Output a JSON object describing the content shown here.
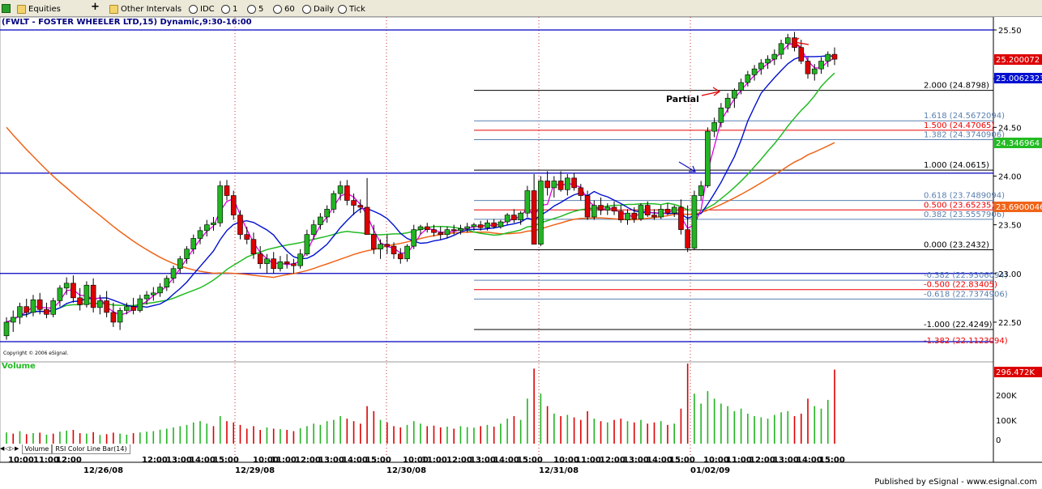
{
  "toolbar": {
    "symbol_icon": "chart-icon",
    "market_label": "Equities",
    "add_icon": "plus-icon",
    "other_intervals_label": "Other Intervals",
    "interval_prefix": "IDC",
    "interval_1": "1",
    "interval_5": "5",
    "interval_60": "60",
    "interval_daily": "Daily",
    "interval_tick": "Tick"
  },
  "chart_title": "(FWLT - FOSTER WHEELER LTD,15) Dynamic,9:30-16:00",
  "copyright": "Copyright © 2006 eSignal.",
  "volume_label": "Volume",
  "bottom_tabs": [
    "Volume",
    "RSI Color Line Bar(14)"
  ],
  "published": "Published by eSignal - www.esignal.com",
  "colors": {
    "up_candle": "#22b422",
    "down_candle": "#dd0000",
    "ma_fast": "#e000e0",
    "ma_mid": "#0010d0",
    "ma_slow": "#22bb22",
    "ma_long": "#f06418",
    "hline": "#0000c0",
    "fib_grey": "#5a80b0",
    "fib_red": "#ee0000",
    "fib_black": "#000000"
  },
  "chart_data": {
    "type": "candlestick",
    "title": "(FWLT - FOSTER WHEELER LTD,15) Dynamic,9:30-16:00",
    "y_axis": {
      "min": 22.3,
      "max": 25.5,
      "ticks": [
        "25.50",
        "25.00",
        "24.50",
        "24.00",
        "23.50",
        "23.00",
        "22.50"
      ]
    },
    "x_axis": {
      "time_labels": [
        "10:00",
        "11:00",
        "12:00",
        "10:00",
        "11:00",
        "12:00",
        "13:00",
        "14:00",
        "15:00",
        "10:00",
        "11:00",
        "12:00",
        "13:00",
        "14:00",
        "15:00",
        "10:00",
        "11:00",
        "12:00",
        "13:00",
        "14:00",
        "15:00",
        "10:00",
        "11:00",
        "12:00",
        "13:00",
        "14:00",
        "15:00"
      ],
      "date_labels": [
        "12/26/08",
        "12/29/08",
        "12/30/08",
        "12/31/08",
        "01/02/09"
      ]
    },
    "price_badges": [
      {
        "value": "25.200072",
        "color": "#dd0000"
      },
      {
        "value": "25.0062323",
        "color": "#0010d0"
      },
      {
        "value": "24.346964",
        "color": "#22bb22"
      },
      {
        "value": "23.6900046",
        "color": "#f06418"
      }
    ],
    "horizontal_lines": [
      25.5,
      24.03,
      23.0,
      22.3
    ],
    "fib_levels": [
      {
        "label": "2.000 (24.8798)",
        "value": 24.8798,
        "color": "black"
      },
      {
        "label": "1.618 (24.5672094)",
        "value": 24.5672,
        "color": "grey"
      },
      {
        "label": "1.500 (24.47065)",
        "value": 24.4707,
        "color": "red"
      },
      {
        "label": "1.382 (24.3740906)",
        "value": 24.3741,
        "color": "grey"
      },
      {
        "label": "1.000 (24.0615)",
        "value": 24.0615,
        "color": "black"
      },
      {
        "label": "0.618 (23.7489094)",
        "value": 23.7489,
        "color": "grey"
      },
      {
        "label": "0.500 (23.65235)",
        "value": 23.6524,
        "color": "red"
      },
      {
        "label": "0.382 (23.5557906)",
        "value": 23.5558,
        "color": "grey"
      },
      {
        "label": "0.000 (23.2432)",
        "value": 23.2432,
        "color": "black"
      },
      {
        "label": "-0.382 (22.9306094)",
        "value": 22.9306,
        "color": "grey"
      },
      {
        "label": "-0.500 (22.83405)",
        "value": 22.8341,
        "color": "red"
      },
      {
        "label": "-0.618 (22.7374906)",
        "value": 22.7375,
        "color": "grey"
      },
      {
        "label": "-1.000 (22.4249)",
        "value": 22.4249,
        "color": "black"
      },
      {
        "label": "-1.382 (22.1123094)",
        "value": 22.1123,
        "color": "red"
      }
    ],
    "annotations": [
      {
        "text": "Partial"
      }
    ],
    "candles": [
      [
        22.36,
        22.55,
        22.32,
        22.5
      ],
      [
        22.5,
        22.62,
        22.4,
        22.55
      ],
      [
        22.55,
        22.7,
        22.48,
        22.66
      ],
      [
        22.66,
        22.74,
        22.55,
        22.6
      ],
      [
        22.6,
        22.78,
        22.56,
        22.73
      ],
      [
        22.73,
        22.8,
        22.58,
        22.63
      ],
      [
        22.63,
        22.7,
        22.54,
        22.58
      ],
      [
        22.58,
        22.75,
        22.55,
        22.72
      ],
      [
        22.72,
        22.88,
        22.66,
        22.85
      ],
      [
        22.85,
        22.96,
        22.78,
        22.9
      ],
      [
        22.9,
        22.98,
        22.7,
        22.75
      ],
      [
        22.75,
        22.85,
        22.62,
        22.68
      ],
      [
        22.68,
        22.92,
        22.65,
        22.88
      ],
      [
        22.88,
        22.95,
        22.6,
        22.65
      ],
      [
        22.65,
        22.78,
        22.58,
        22.72
      ],
      [
        22.72,
        22.82,
        22.55,
        22.6
      ],
      [
        22.6,
        22.7,
        22.45,
        22.5
      ],
      [
        22.5,
        22.65,
        22.42,
        22.62
      ],
      [
        22.62,
        22.7,
        22.58,
        22.66
      ],
      [
        22.66,
        22.75,
        22.58,
        22.62
      ],
      [
        22.62,
        22.78,
        22.6,
        22.74
      ],
      [
        22.74,
        22.82,
        22.68,
        22.78
      ],
      [
        22.78,
        22.86,
        22.72,
        22.8
      ],
      [
        22.8,
        22.9,
        22.76,
        22.86
      ],
      [
        22.86,
        22.98,
        22.82,
        22.95
      ],
      [
        22.95,
        23.08,
        22.9,
        23.05
      ],
      [
        23.05,
        23.18,
        23.0,
        23.15
      ],
      [
        23.15,
        23.28,
        23.1,
        23.25
      ],
      [
        23.25,
        23.4,
        23.2,
        23.36
      ],
      [
        23.36,
        23.48,
        23.3,
        23.44
      ],
      [
        23.44,
        23.55,
        23.38,
        23.5
      ],
      [
        23.5,
        23.58,
        23.44,
        23.52
      ],
      [
        23.52,
        23.95,
        23.48,
        23.9
      ],
      [
        23.9,
        23.96,
        23.75,
        23.8
      ],
      [
        23.8,
        23.85,
        23.55,
        23.6
      ],
      [
        23.6,
        23.65,
        23.35,
        23.4
      ],
      [
        23.4,
        23.48,
        23.3,
        23.35
      ],
      [
        23.35,
        23.42,
        23.15,
        23.2
      ],
      [
        23.2,
        23.28,
        23.05,
        23.1
      ],
      [
        23.1,
        23.2,
        23.0,
        23.15
      ],
      [
        23.15,
        23.22,
        23.0,
        23.05
      ],
      [
        23.05,
        23.18,
        23.02,
        23.12
      ],
      [
        23.12,
        23.2,
        23.05,
        23.1
      ],
      [
        23.1,
        23.15,
        23.0,
        23.08
      ],
      [
        23.08,
        23.25,
        23.05,
        23.2
      ],
      [
        23.2,
        23.45,
        23.18,
        23.4
      ],
      [
        23.4,
        23.55,
        23.35,
        23.5
      ],
      [
        23.5,
        23.62,
        23.45,
        23.58
      ],
      [
        23.58,
        23.7,
        23.52,
        23.66
      ],
      [
        23.66,
        23.85,
        23.62,
        23.82
      ],
      [
        23.82,
        23.95,
        23.75,
        23.9
      ],
      [
        23.9,
        23.96,
        23.7,
        23.75
      ],
      [
        23.75,
        23.82,
        23.6,
        23.7
      ],
      [
        23.7,
        23.76,
        23.62,
        23.68
      ],
      [
        23.68,
        23.98,
        23.5,
        23.4
      ],
      [
        23.4,
        23.5,
        23.2,
        23.25
      ],
      [
        23.25,
        23.35,
        23.15,
        23.3
      ],
      [
        23.3,
        23.4,
        23.2,
        23.28
      ],
      [
        23.28,
        23.32,
        23.15,
        23.2
      ],
      [
        23.2,
        23.26,
        23.1,
        23.15
      ],
      [
        23.15,
        23.3,
        23.12,
        23.28
      ],
      [
        23.28,
        23.5,
        23.25,
        23.45
      ],
      [
        23.45,
        23.5,
        23.4,
        23.48
      ],
      [
        23.48,
        23.52,
        23.42,
        23.45
      ],
      [
        23.45,
        23.5,
        23.38,
        23.42
      ],
      [
        23.42,
        23.48,
        23.35,
        23.4
      ],
      [
        23.4,
        23.48,
        23.36,
        23.45
      ],
      [
        23.45,
        23.5,
        23.4,
        23.44
      ],
      [
        23.44,
        23.5,
        23.4,
        23.46
      ],
      [
        23.46,
        23.52,
        23.42,
        23.48
      ],
      [
        23.48,
        23.52,
        23.44,
        23.5
      ],
      [
        23.5,
        23.54,
        23.44,
        23.47
      ],
      [
        23.47,
        23.55,
        23.44,
        23.52
      ],
      [
        23.52,
        23.56,
        23.46,
        23.48
      ],
      [
        23.48,
        23.55,
        23.46,
        23.53
      ],
      [
        23.53,
        23.62,
        23.5,
        23.6
      ],
      [
        23.6,
        23.66,
        23.52,
        23.55
      ],
      [
        23.55,
        23.64,
        23.5,
        23.62
      ],
      [
        23.62,
        23.9,
        23.58,
        23.85
      ],
      [
        23.85,
        24.02,
        23.3,
        23.3
      ],
      [
        23.3,
        24.0,
        23.28,
        23.95
      ],
      [
        23.95,
        24.05,
        23.8,
        23.88
      ],
      [
        23.88,
        24.0,
        23.78,
        23.95
      ],
      [
        23.95,
        24.05,
        23.84,
        23.86
      ],
      [
        23.86,
        24.02,
        23.8,
        23.98
      ],
      [
        23.98,
        24.03,
        23.85,
        23.88
      ],
      [
        23.88,
        23.92,
        23.75,
        23.8
      ],
      [
        23.8,
        23.85,
        23.55,
        23.58
      ],
      [
        23.58,
        23.75,
        23.55,
        23.7
      ],
      [
        23.7,
        23.78,
        23.6,
        23.65
      ],
      [
        23.65,
        23.72,
        23.6,
        23.68
      ],
      [
        23.68,
        23.74,
        23.6,
        23.64
      ],
      [
        23.64,
        23.7,
        23.52,
        23.55
      ],
      [
        23.55,
        23.66,
        23.5,
        23.62
      ],
      [
        23.62,
        23.68,
        23.52,
        23.56
      ],
      [
        23.56,
        23.72,
        23.54,
        23.7
      ],
      [
        23.7,
        23.74,
        23.58,
        23.6
      ],
      [
        23.6,
        23.66,
        23.55,
        23.58
      ],
      [
        23.58,
        23.7,
        23.56,
        23.66
      ],
      [
        23.66,
        23.72,
        23.6,
        23.62
      ],
      [
        23.62,
        23.7,
        23.58,
        23.68
      ],
      [
        23.68,
        23.76,
        23.4,
        23.45
      ],
      [
        23.45,
        23.7,
        23.22,
        23.26
      ],
      [
        23.26,
        23.85,
        23.24,
        23.8
      ],
      [
        23.8,
        23.95,
        23.75,
        23.9
      ],
      [
        23.9,
        24.5,
        23.88,
        24.46
      ],
      [
        24.46,
        24.6,
        24.4,
        24.55
      ],
      [
        24.55,
        24.75,
        24.5,
        24.7
      ],
      [
        24.7,
        24.85,
        24.65,
        24.8
      ],
      [
        24.8,
        24.9,
        24.7,
        24.88
      ],
      [
        24.88,
        25.0,
        24.84,
        24.96
      ],
      [
        24.96,
        25.08,
        24.92,
        25.04
      ],
      [
        25.04,
        25.14,
        24.98,
        25.1
      ],
      [
        25.1,
        25.2,
        25.04,
        25.16
      ],
      [
        25.16,
        25.24,
        25.1,
        25.2
      ],
      [
        25.2,
        25.3,
        25.14,
        25.25
      ],
      [
        25.25,
        25.4,
        25.2,
        25.36
      ],
      [
        25.36,
        25.46,
        25.3,
        25.42
      ],
      [
        25.42,
        25.48,
        25.28,
        25.32
      ],
      [
        25.32,
        25.4,
        25.15,
        25.18
      ],
      [
        25.18,
        25.22,
        25.0,
        25.05
      ],
      [
        25.05,
        25.15,
        24.98,
        25.1
      ],
      [
        25.1,
        25.22,
        25.05,
        25.18
      ],
      [
        25.18,
        25.28,
        25.12,
        25.25
      ],
      [
        25.25,
        25.32,
        25.14,
        25.2
      ]
    ],
    "volume": {
      "ticks": [
        "200K",
        "100K",
        "0"
      ],
      "last_value": "296.472K",
      "bars": [
        [
          45,
          1
        ],
        [
          40,
          0
        ],
        [
          50,
          1
        ],
        [
          38,
          0
        ],
        [
          42,
          1
        ],
        [
          44,
          0
        ],
        [
          36,
          1
        ],
        [
          40,
          0
        ],
        [
          48,
          1
        ],
        [
          52,
          1
        ],
        [
          55,
          0
        ],
        [
          42,
          0
        ],
        [
          40,
          1
        ],
        [
          46,
          0
        ],
        [
          35,
          1
        ],
        [
          38,
          0
        ],
        [
          44,
          0
        ],
        [
          40,
          1
        ],
        [
          36,
          1
        ],
        [
          42,
          0
        ],
        [
          45,
          1
        ],
        [
          48,
          1
        ],
        [
          50,
          1
        ],
        [
          56,
          1
        ],
        [
          60,
          1
        ],
        [
          65,
          1
        ],
        [
          70,
          1
        ],
        [
          75,
          1
        ],
        [
          85,
          1
        ],
        [
          90,
          1
        ],
        [
          80,
          1
        ],
        [
          70,
          0
        ],
        [
          110,
          1
        ],
        [
          90,
          0
        ],
        [
          85,
          0
        ],
        [
          75,
          0
        ],
        [
          60,
          0
        ],
        [
          70,
          0
        ],
        [
          55,
          0
        ],
        [
          65,
          1
        ],
        [
          60,
          0
        ],
        [
          58,
          1
        ],
        [
          55,
          0
        ],
        [
          50,
          0
        ],
        [
          62,
          1
        ],
        [
          70,
          1
        ],
        [
          80,
          1
        ],
        [
          75,
          1
        ],
        [
          90,
          1
        ],
        [
          95,
          1
        ],
        [
          110,
          1
        ],
        [
          100,
          0
        ],
        [
          90,
          0
        ],
        [
          80,
          0
        ],
        [
          150,
          0
        ],
        [
          130,
          0
        ],
        [
          95,
          1
        ],
        [
          85,
          0
        ],
        [
          70,
          0
        ],
        [
          65,
          0
        ],
        [
          75,
          1
        ],
        [
          90,
          1
        ],
        [
          80,
          1
        ],
        [
          70,
          0
        ],
        [
          72,
          0
        ],
        [
          65,
          0
        ],
        [
          68,
          1
        ],
        [
          60,
          0
        ],
        [
          70,
          1
        ],
        [
          66,
          1
        ],
        [
          64,
          1
        ],
        [
          70,
          0
        ],
        [
          75,
          1
        ],
        [
          68,
          0
        ],
        [
          80,
          1
        ],
        [
          100,
          1
        ],
        [
          110,
          0
        ],
        [
          95,
          1
        ],
        [
          180,
          1
        ],
        [
          300,
          0
        ],
        [
          200,
          1
        ],
        [
          150,
          0
        ],
        [
          120,
          1
        ],
        [
          110,
          0
        ],
        [
          115,
          1
        ],
        [
          105,
          0
        ],
        [
          95,
          0
        ],
        [
          130,
          0
        ],
        [
          100,
          1
        ],
        [
          90,
          0
        ],
        [
          85,
          1
        ],
        [
          95,
          0
        ],
        [
          100,
          0
        ],
        [
          90,
          1
        ],
        [
          85,
          0
        ],
        [
          95,
          1
        ],
        [
          80,
          0
        ],
        [
          85,
          0
        ],
        [
          90,
          1
        ],
        [
          75,
          0
        ],
        [
          80,
          1
        ],
        [
          140,
          0
        ],
        [
          320,
          0
        ],
        [
          200,
          1
        ],
        [
          160,
          1
        ],
        [
          210,
          1
        ],
        [
          180,
          1
        ],
        [
          160,
          1
        ],
        [
          150,
          1
        ],
        [
          130,
          1
        ],
        [
          140,
          1
        ],
        [
          120,
          1
        ],
        [
          110,
          1
        ],
        [
          105,
          1
        ],
        [
          100,
          1
        ],
        [
          115,
          1
        ],
        [
          125,
          1
        ],
        [
          130,
          1
        ],
        [
          110,
          0
        ],
        [
          120,
          0
        ],
        [
          180,
          0
        ],
        [
          150,
          1
        ],
        [
          140,
          1
        ],
        [
          175,
          1
        ],
        [
          296,
          0
        ]
      ]
    }
  }
}
